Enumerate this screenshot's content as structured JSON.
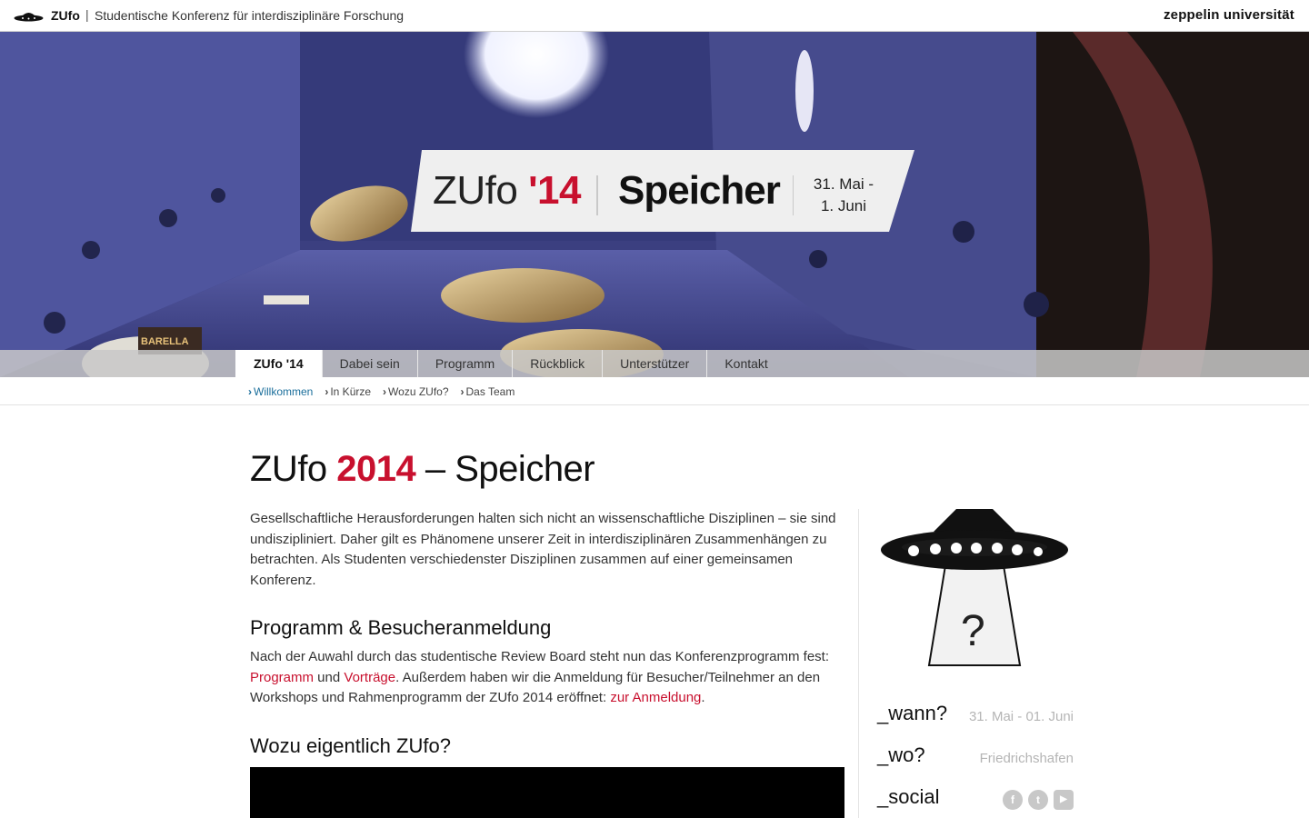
{
  "topbar": {
    "brand": "ZUfo",
    "separator": "|",
    "tagline": "Studentische Konferenz für interdisziplinäre Forschung",
    "university": "zeppelin universität"
  },
  "hero": {
    "zufo_prefix": "ZUfo ",
    "zufo_year": "'14",
    "title": "Speicher",
    "date_line1": "31. Mai -",
    "date_line2": "1. Juni",
    "sign_text": "BARELLA"
  },
  "nav": {
    "items": [
      {
        "label": "ZUfo '14",
        "active": true
      },
      {
        "label": "Dabei sein"
      },
      {
        "label": "Programm"
      },
      {
        "label": "Rückblick"
      },
      {
        "label": "Unterstützer"
      },
      {
        "label": "Kontakt"
      }
    ]
  },
  "subnav": {
    "items": [
      {
        "label": "Willkommen",
        "active": true
      },
      {
        "label": "In Kürze"
      },
      {
        "label": "Wozu ZUfo?"
      },
      {
        "label": "Das Team"
      }
    ]
  },
  "page": {
    "title_prefix": "ZUfo ",
    "title_year": "2014",
    "title_suffix": " – Speicher",
    "intro": "Gesellschaftliche Herausforderungen halten sich nicht an wissenschaftliche Disziplinen – sie sind undiszipliniert. Daher gilt es Phänomene unserer Zeit in interdisziplinären Zusammenhängen zu betrachten. Als Studenten verschiedenster Disziplinen zusammen auf einer gemeinsamen Konferenz.",
    "section1_heading": "Programm & Besucheranmeldung",
    "section1_text_a": "Nach der Auwahl durch das studentische Review Board steht nun das Konferenzprogramm fest: ",
    "section1_link1": "Programm",
    "section1_text_b": " und ",
    "section1_link2": "Vorträge",
    "section1_text_c": ". Außerdem haben wir die Anmeldung für Besucher/Teilnehmer an den Workshops und Rahmenprogramm der ZUfo 2014 eröffnet: ",
    "section1_link3": "zur Anmeldung",
    "section1_text_d": ".",
    "section2_heading": "Wozu eigentlich ZUfo?"
  },
  "sidebar": {
    "question_mark": "?",
    "when_label": "_wann?",
    "when_value": "31. Mai - 01. Juni",
    "where_label": "_wo?",
    "where_value": "Friedrichshafen",
    "social_label": "_social",
    "social_icons": [
      {
        "icon": "facebook-icon",
        "glyph": "f"
      },
      {
        "icon": "twitter-icon",
        "glyph": "t"
      },
      {
        "icon": "youtube-icon",
        "glyph": "▶"
      }
    ]
  },
  "colors": {
    "accent": "#c8102e",
    "subnav_active": "#1a6e9b"
  }
}
